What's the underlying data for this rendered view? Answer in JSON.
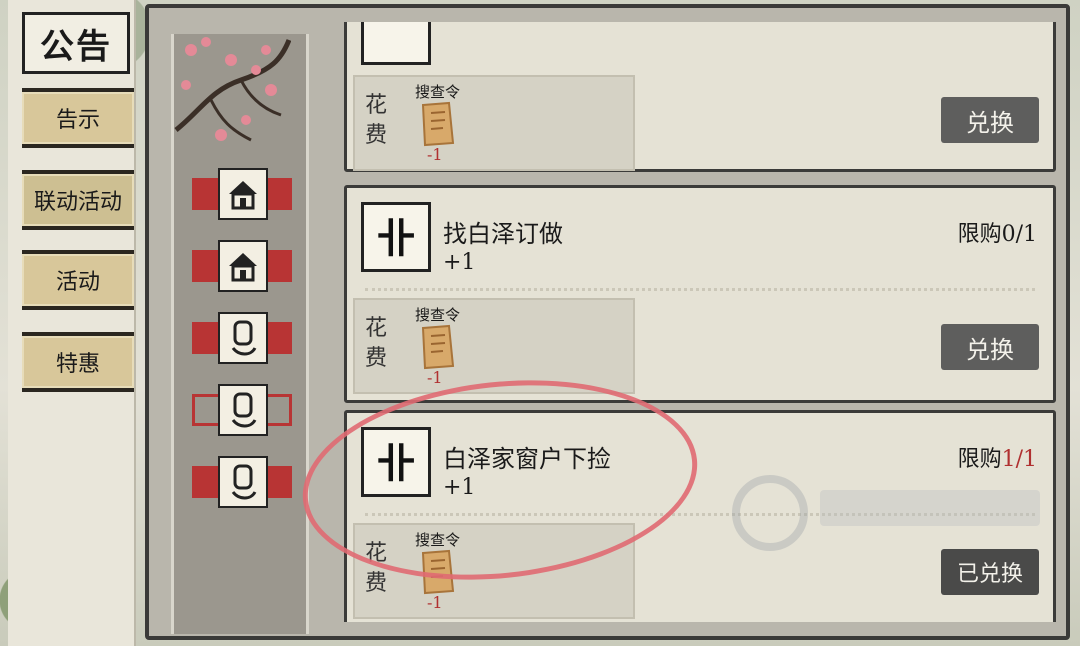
{
  "notice_title": "公告",
  "tabs": [
    {
      "label": "告示"
    },
    {
      "label": "联动活动"
    },
    {
      "label": "活动"
    },
    {
      "label": "特惠"
    }
  ],
  "items": [
    {
      "name": "",
      "qty": "",
      "limit_label": "",
      "cost_label": "花费",
      "cost_item": "搜查令",
      "cost_amount": "-1",
      "button": "兑换"
    },
    {
      "name": "找白泽订做",
      "qty": "+1",
      "limit_label": "限购",
      "limit_value": "0/1",
      "cost_label": "花费",
      "cost_item": "搜查令",
      "cost_amount": "-1",
      "button": "兑换"
    },
    {
      "name": "白泽家窗户下捡",
      "qty": "+1",
      "limit_label": "限购",
      "limit_value": "1/1",
      "cost_label": "花费",
      "cost_item": "搜查令",
      "cost_amount": "-1",
      "button": "已兑换"
    }
  ],
  "colors": {
    "accent_red": "#b83434",
    "limit_reached": "#b03030",
    "button": "#5e5e5d"
  }
}
